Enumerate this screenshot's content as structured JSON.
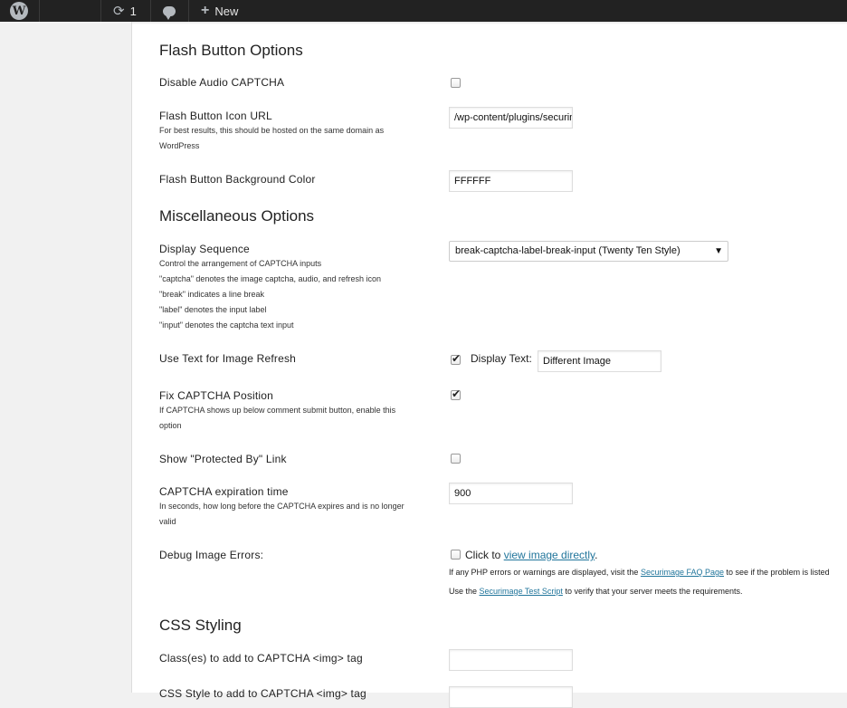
{
  "adminbar": {
    "updates_count": "1",
    "new_label": "New"
  },
  "sections": {
    "flash": {
      "title": "Flash Button Options",
      "disable_audio": {
        "label": "Disable Audio CAPTCHA",
        "checked": false
      },
      "icon_url": {
        "label": "Flash Button Icon URL",
        "desc_line1": "For best results, this should be hosted on the same domain as",
        "desc_line2": "WordPress",
        "value": "/wp-content/plugins/securimage-wp/"
      },
      "bg_color": {
        "label": "Flash Button Background Color",
        "value": "FFFFFF"
      }
    },
    "misc": {
      "title": "Miscellaneous Options",
      "display_sequence": {
        "label": "Display Sequence",
        "desc": [
          "Control the arrangement of CAPTCHA inputs",
          "\"captcha\" denotes the image captcha, audio, and refresh icon",
          "\"break\" indicates a line break",
          "\"label\" denotes the input label",
          "\"input\" denotes the captcha text input"
        ],
        "selected": "break-captcha-label-break-input (Twenty Ten Style)"
      },
      "text_refresh": {
        "label": "Use Text for Image Refresh",
        "checked": true,
        "display_text_label": "Display Text:",
        "display_text_value": "Different Image"
      },
      "fix_position": {
        "label": "Fix CAPTCHA Position",
        "desc_line1": "If CAPTCHA shows up below comment submit button, enable this",
        "desc_line2": "option",
        "checked": true
      },
      "protected_by": {
        "label": "Show \"Protected By\" Link",
        "checked": false
      },
      "expiration": {
        "label": "CAPTCHA expiration time",
        "desc_line1": "In seconds, how long before the CAPTCHA expires and is no longer",
        "desc_line2": "valid",
        "value": "900"
      },
      "debug": {
        "label": "Debug Image Errors:",
        "click_prefix": "Click to",
        "click_link": "view image directly",
        "click_suffix": ".",
        "note1_prefix": "If any PHP errors or warnings are displayed, visit the",
        "note1_link": "Securimage FAQ Page",
        "note1_suffix": "to see if the problem is listed",
        "note2_prefix": "Use the",
        "note2_link": "Securimage Test Script",
        "note2_suffix": "to verify that your server meets the requirements."
      }
    },
    "css": {
      "title": "CSS Styling",
      "img_class": {
        "label": "Class(es) to add to CAPTCHA <img> tag",
        "value": ""
      },
      "next_label": "CSS Style to add to CAPTCHA <img> tag"
    }
  },
  "colors": {
    "adminbar": "#222222",
    "link": "#21759b",
    "page_bg": "#f1f1f1"
  }
}
